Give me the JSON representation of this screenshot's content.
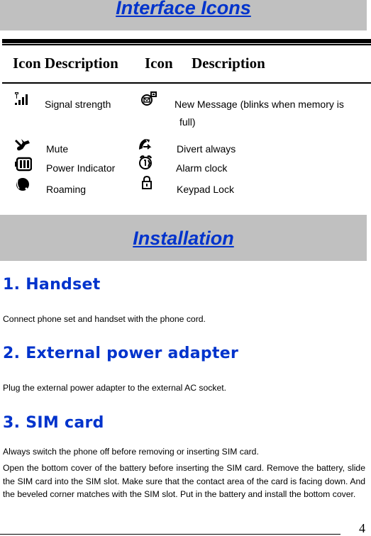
{
  "sections": {
    "interface_icons": {
      "title": "Interface Icons"
    },
    "installation": {
      "title": "Installation"
    }
  },
  "icon_table": {
    "headers": [
      "Icon Description",
      "Icon",
      "Description"
    ],
    "left_column": [
      {
        "icon": "signal-strength-icon",
        "description": "Signal strength"
      },
      {
        "icon": "mute-icon",
        "description": "Mute"
      },
      {
        "icon": "battery-icon",
        "description": "Power Indicator"
      },
      {
        "icon": "roaming-icon",
        "description": "Roaming"
      }
    ],
    "right_column": [
      {
        "icon": "new-message-icon",
        "description_line1": "New Message (blinks when memory is",
        "description_line2": "full)"
      },
      {
        "icon": "divert-icon",
        "description": "Divert always"
      },
      {
        "icon": "alarm-clock-icon",
        "description": "Alarm clock"
      },
      {
        "icon": "lock-icon",
        "description": "Keypad Lock"
      }
    ]
  },
  "steps": [
    {
      "heading": "1.  Handset",
      "text": "Connect phone set and handset with the phone cord."
    },
    {
      "heading": "2.  External power adapter",
      "text": "Plug the external power adapter to the external AC socket."
    },
    {
      "heading": "3.  SIM card",
      "text": "Always switch the phone off before removing or inserting SIM card.",
      "paragraph": "Open the bottom cover of the battery before inserting the SIM card. Remove the battery, slide the SIM card into the SIM slot. Make sure that the contact area of the card is facing down. And the beveled corner matches with the SIM slot. Put in the battery and install the bottom cover."
    }
  ],
  "footer": {
    "page_number": "4"
  },
  "colors": {
    "heading_blue": "#0033cc",
    "banner_gray": "#c0c0c0"
  }
}
